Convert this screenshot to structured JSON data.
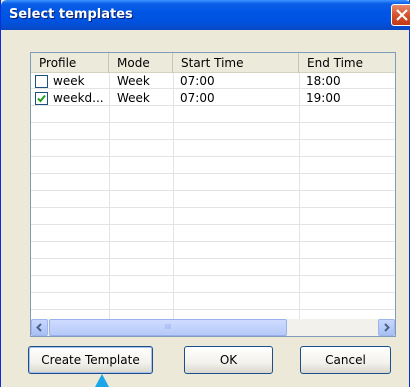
{
  "window": {
    "title": "Select templates"
  },
  "table": {
    "columns": [
      "Profile",
      "Mode",
      "Start Time",
      "End Time"
    ],
    "rows": [
      {
        "checked": false,
        "profile": "week",
        "mode": "Week",
        "start": "07:00",
        "end": "18:00"
      },
      {
        "checked": true,
        "profile": "weekd...",
        "mode": "Week",
        "start": "07:00",
        "end": "19:00"
      }
    ]
  },
  "scrollbar": {
    "grip_label": "III"
  },
  "buttons": {
    "create_template": "Create Template",
    "ok": "OK",
    "cancel": "Cancel"
  },
  "colors": {
    "titlebar": "#0055e5",
    "close": "#d4522e",
    "cursor": "#1aa6e8"
  }
}
